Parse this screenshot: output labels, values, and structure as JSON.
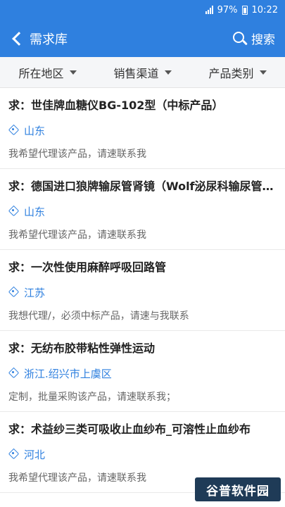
{
  "status_bar": {
    "battery": "97%",
    "time": "10:22"
  },
  "nav": {
    "back_label": "需求库",
    "search_label": "搜索"
  },
  "filters": [
    {
      "label": "所在地区"
    },
    {
      "label": "销售渠道"
    },
    {
      "label": "产品类别"
    }
  ],
  "items": [
    {
      "title": "求：世佳牌血糖仪BG-102型（中标产品）",
      "location": "山东",
      "desc": "我希望代理该产品，请速联系我"
    },
    {
      "title": "求：德国进口狼牌输尿管肾镜（Wolf泌尿科输尿管肾镜）",
      "location": "山东",
      "desc": "我希望代理该产品，请速联系我"
    },
    {
      "title": "求：一次性使用麻醉呼吸回路管",
      "location": "江苏",
      "desc": "我想代理/，必须中标产品，请速与我联系"
    },
    {
      "title": "求：无纺布胶带粘性弹性运动",
      "location": "浙江.绍兴市上虞区",
      "desc": "定制，批量采购该产品，请速联系我；"
    },
    {
      "title": "求：术益纱三类可吸收止血纱布_可溶性止血纱布",
      "location": "河北",
      "desc": "我希望代理该产品，请速联系我"
    }
  ],
  "watermark": "谷普软件园"
}
